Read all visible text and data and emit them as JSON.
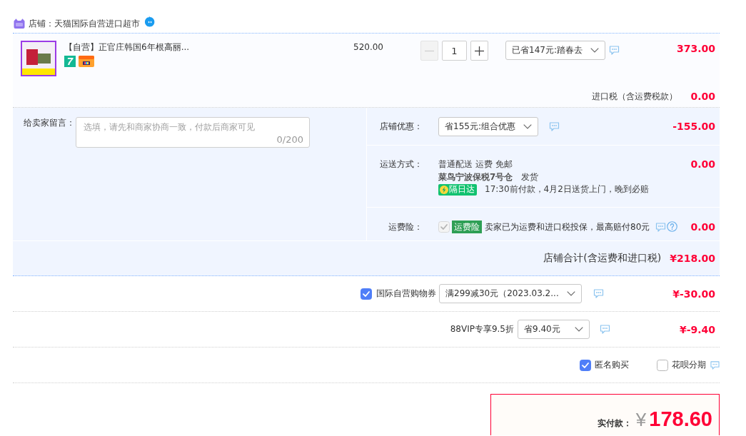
{
  "shop": {
    "name": "店铺：天猫国际自营进口超市"
  },
  "item": {
    "title": "【自营】正官庄韩国6年根高丽...",
    "tags": [
      {
        "kind": "number",
        "text": "7"
      },
      {
        "kind": "card"
      }
    ],
    "unit_price": "520.00",
    "quantity": {
      "value": "1",
      "decrease_disabled": true
    },
    "promotion": "已省147元:踏春去",
    "subtotal": "373.00",
    "import_tax": {
      "label": "进口税（含运费税款）",
      "amount": "0.00"
    }
  },
  "message": {
    "label": "给卖家留言：",
    "placeholder": "选填，请先和商家协商一致，付款后商家可见",
    "counter": "0/200"
  },
  "shop_discount": {
    "label": "店铺优惠：",
    "value": "省155元:组合优惠",
    "amount": "-155.00"
  },
  "shipping": {
    "label": "运送方式：",
    "method": "普通配送 运费 免邮",
    "warehouse": "菜鸟宁波保税7号仓",
    "dispatch": "发货",
    "tag": "隔日达",
    "promise": "17:30前付款，4月2日送货上门，晚到必赔",
    "amount": "0.00"
  },
  "insurance": {
    "label": "运费险：",
    "checked": true,
    "disabled": true,
    "tag": "运费险",
    "text": "卖家已为运费和进口税投保，最高赔付80元",
    "amount": "0.00"
  },
  "shop_total": {
    "label": "店铺合计(含运费和进口税)",
    "amount": "¥218.00"
  },
  "coupon": {
    "checked": true,
    "label": "国际自营购物券",
    "value": "满299减30元（2023.03.2...",
    "amount": "¥-30.00"
  },
  "vip_discount": {
    "label": "88VIP专享9.5折",
    "value": "省9.40元",
    "amount": "¥-9.40"
  },
  "options": [
    {
      "label": "匿名购买",
      "checked": true
    },
    {
      "label": "花呗分期",
      "checked": false
    }
  ],
  "total": {
    "label": "实付款：",
    "currency": "¥",
    "amount": "178.60"
  }
}
